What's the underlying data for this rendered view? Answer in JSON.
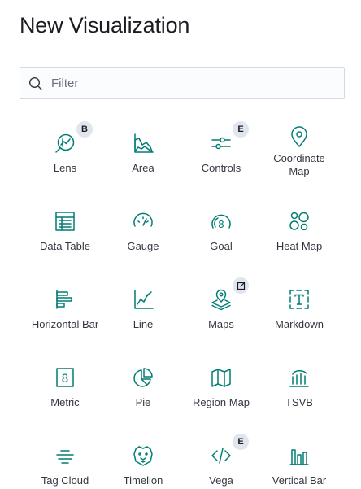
{
  "page_title": "New Visualization",
  "search": {
    "placeholder": "Filter",
    "value": ""
  },
  "accent_color": "#017d73",
  "visualizations": [
    {
      "label": "Lens",
      "icon": "lens-icon",
      "badge": "B"
    },
    {
      "label": "Area",
      "icon": "area-chart-icon"
    },
    {
      "label": "Controls",
      "icon": "controls-icon",
      "badge": "E"
    },
    {
      "label": "Coordinate Map",
      "icon": "map-pin-icon"
    },
    {
      "label": "Data Table",
      "icon": "data-table-icon"
    },
    {
      "label": "Gauge",
      "icon": "gauge-icon"
    },
    {
      "label": "Goal",
      "icon": "goal-icon"
    },
    {
      "label": "Heat Map",
      "icon": "heat-map-icon"
    },
    {
      "label": "Horizontal Bar",
      "icon": "horizontal-bar-icon"
    },
    {
      "label": "Line",
      "icon": "line-chart-icon"
    },
    {
      "label": "Maps",
      "icon": "maps-icon",
      "badge": "external-link-icon"
    },
    {
      "label": "Markdown",
      "icon": "markdown-icon"
    },
    {
      "label": "Metric",
      "icon": "metric-icon"
    },
    {
      "label": "Pie",
      "icon": "pie-chart-icon"
    },
    {
      "label": "Region Map",
      "icon": "region-map-icon"
    },
    {
      "label": "TSVB",
      "icon": "tsvb-icon"
    },
    {
      "label": "Tag Cloud",
      "icon": "tag-cloud-icon"
    },
    {
      "label": "Timelion",
      "icon": "timelion-icon"
    },
    {
      "label": "Vega",
      "icon": "code-icon",
      "badge": "E"
    },
    {
      "label": "Vertical Bar",
      "icon": "vertical-bar-icon"
    }
  ]
}
